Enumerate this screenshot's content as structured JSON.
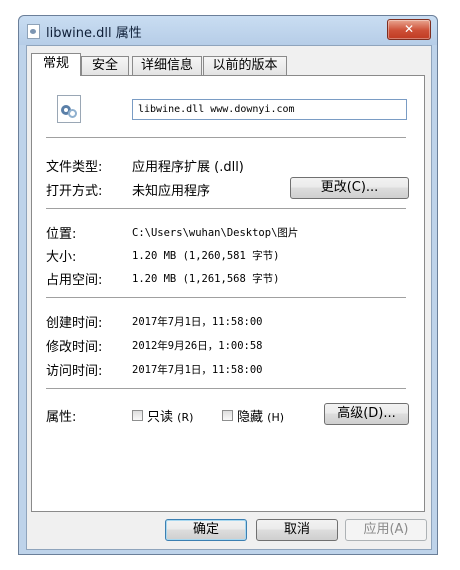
{
  "window": {
    "title": "libwine.dll 属性",
    "close_glyph": "✕"
  },
  "tabs": [
    {
      "label": "常规",
      "active": true
    },
    {
      "label": "安全"
    },
    {
      "label": "详细信息"
    },
    {
      "label": "以前的版本"
    }
  ],
  "general": {
    "icon": "dll-file-icon",
    "file_name": "libwine.dll www.downyi.com",
    "type_label": "文件类型:",
    "type_value": "应用程序扩展 (.dll)",
    "opens_with_label": "打开方式:",
    "opens_with_value": "未知应用程序",
    "change_button": "更改(C)...",
    "location_label": "位置:",
    "location_value": "C:\\Users\\wuhan\\Desktop\\图片",
    "size_label": "大小:",
    "size_value": "1.20 MB (1,260,581 字节)",
    "size_on_disk_label": "占用空间:",
    "size_on_disk_value": "1.20 MB (1,261,568 字节)",
    "created_label": "创建时间:",
    "created_value": "2017年7月1日，11:58:00",
    "modified_label": "修改时间:",
    "modified_value": "2012年9月26日，1:00:58",
    "accessed_label": "访问时间:",
    "accessed_value": "2017年7月1日，11:58:00",
    "attributes_label": "属性:",
    "readonly_label": "只读",
    "readonly_key": "(R)",
    "hidden_label": "隐藏",
    "hidden_key": "(H)",
    "advanced_button": "高级(D)..."
  },
  "footer": {
    "ok": "确定",
    "cancel": "取消",
    "apply": "应用(A)"
  },
  "colors": {
    "frame": "#bed3ea",
    "close_button": "#cd4f36",
    "default_button_border": "#3c7fb1"
  }
}
